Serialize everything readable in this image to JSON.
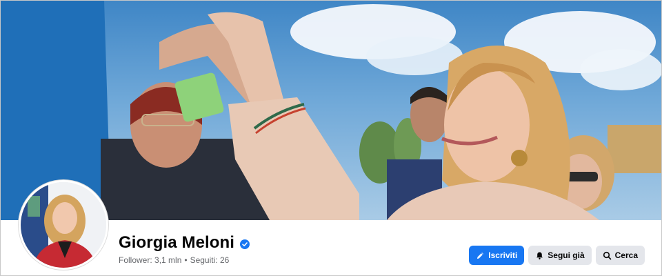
{
  "page": {
    "name": "Giorgia Meloni",
    "verified": true,
    "stats": {
      "followers": "Follower: 3,1 mln",
      "separator": "•",
      "following": "Seguiti: 26"
    }
  },
  "actions": {
    "subscribe_label": "Iscriviti",
    "following_label": "Segui già",
    "search_label": "Cerca"
  },
  "icons": {
    "verified": "verified-badge-icon",
    "subscribe": "pencil-icon",
    "following": "bell-icon",
    "search": "search-icon"
  },
  "colors": {
    "primary": "#1877f2",
    "secondary_button": "#e4e6eb",
    "text": "#050505",
    "muted_text": "#65676b"
  }
}
